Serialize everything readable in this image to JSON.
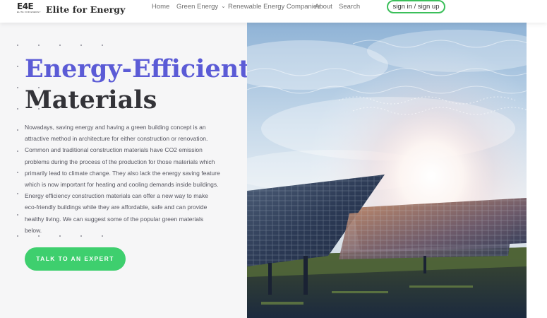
{
  "header": {
    "logo_mark": "E4E",
    "logo_subtext": "ELITE FOR ENERGY",
    "site_name": "Elite for Energy",
    "nav": [
      {
        "label": "Home"
      },
      {
        "label": "Green Energy"
      },
      {
        "label": "Renewable Energy Companies"
      },
      {
        "label": "About"
      },
      {
        "label": "Search"
      }
    ],
    "signin_label": "sign in / sign up"
  },
  "hero": {
    "title_line1": "Energy-Efficient",
    "title_line2": "Materials",
    "body": "Nowadays, saving energy and having a green building concept is an attractive method in architecture for either construction or renovation. Common and traditional construction materials have CO2 emission problems during the process of the production for those materials which primarily lead to climate change. They also lack the energy saving feature which is now important for heating and cooling demands inside buildings. Energy efficiency construction materials can offer a new way to make eco-friendly buildings while they are affordable, safe and can provide healthy living. We can suggest some of the popular green materials below.",
    "cta_label": "TALK TO AN EXPERT"
  },
  "colors": {
    "accent_green": "#3ecf6e",
    "title_blue": "#5b5bd6",
    "title_dark": "#333338",
    "panel_bg": "#f6f6f7"
  },
  "icons": {
    "nav_dropdown": "chevron-down-icon"
  }
}
